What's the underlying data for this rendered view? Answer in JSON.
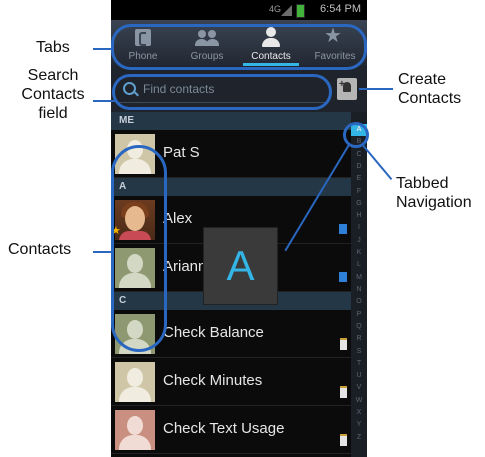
{
  "status": {
    "time": "6:54 PM",
    "network": "4G"
  },
  "tabs": [
    {
      "label": "Phone",
      "icon": "phone-icon",
      "active": false
    },
    {
      "label": "Groups",
      "icon": "groups-icon",
      "active": false
    },
    {
      "label": "Contacts",
      "icon": "person-icon",
      "active": true
    },
    {
      "label": "Favorites",
      "icon": "star-icon",
      "active": false
    }
  ],
  "search": {
    "placeholder": "Find contacts"
  },
  "sections": [
    {
      "header": "ME"
    },
    {
      "header": "A"
    },
    {
      "header": "C"
    }
  ],
  "contacts": [
    {
      "name": "Pat S",
      "avatar": "beige-silhouette"
    },
    {
      "name": "Alex",
      "avatar": "photo",
      "favorite": true,
      "badge": "blue"
    },
    {
      "name": "Arianna",
      "avatar": "green-silhouette",
      "badge": "blue"
    },
    {
      "name": "Check Balance",
      "avatar": "green-silhouette",
      "badge": "white"
    },
    {
      "name": "Check Minutes",
      "avatar": "beige-silhouette",
      "badge": "white"
    },
    {
      "name": "Check Text Usage",
      "avatar": "rose-silhouette",
      "badge": "white"
    }
  ],
  "index_letters": [
    "A",
    "B",
    "C",
    "D",
    "E",
    "F",
    "G",
    "H",
    "I",
    "J",
    "K",
    "L",
    "M",
    "N",
    "O",
    "P",
    "Q",
    "R",
    "S",
    "T",
    "U",
    "V",
    "W",
    "X",
    "Y",
    "Z"
  ],
  "popup_letter": "A",
  "callouts": {
    "tabs": "Tabs",
    "search_line1": "Search",
    "search_line2": "Contacts",
    "search_line3": "field",
    "create_line1": "Create",
    "create_line2": "Contacts",
    "tabbed_line1": "Tabbed",
    "tabbed_line2": "Navigation",
    "contacts": "Contacts"
  },
  "colors": {
    "accent": "#33b5e5",
    "callout": "#2a67c0"
  }
}
